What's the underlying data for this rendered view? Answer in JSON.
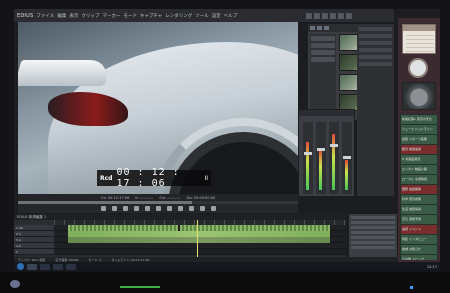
{
  "app": {
    "name": "EDIUS",
    "menu": [
      "ファイル",
      "編集",
      "表示",
      "クリップ",
      "マーカー",
      "モード",
      "キャプチャ",
      "レンダリング",
      "ツール",
      "設定",
      "ヘルプ"
    ]
  },
  "viewer": {
    "timecode_label": "Rcd",
    "timecode_value": "00 : 12 : 17 : 06",
    "timecode_suffix": "II",
    "status": [
      "Cur 00:12:17:06",
      "In --:--:--:--",
      "Out --:--:--:--",
      "Dur 00:00:00:00"
    ],
    "scrub_progress": 0.62
  },
  "timeline": {
    "title": "EDIUS 新規編集 1",
    "tracks": [
      "1 VA",
      "2 V",
      "3 A",
      "4 A",
      "T"
    ],
    "playhead_fraction": 0.49
  },
  "statusbar": [
    "ディスク: 82% 使用",
    "空き容量 100GB",
    "カード: 2",
    "タイムライン: 00:12:17:06"
  ],
  "sidebar": {
    "news_items": [
      "新着記事1 東京の天気",
      "ニュース ヘッドライン",
      "話題 スポーツ結果",
      "経済 株価速報",
      "IT 新製品発表",
      "エンタメ 映画公開",
      "ローカル 交通情報",
      "国際 会談開催",
      "科学 研究成果",
      "生活 健康情報",
      "天気 週間予報",
      "速報 イベント",
      "特集 インタビュー",
      "地域 お知らせ",
      "その他 トピック"
    ]
  },
  "taskbar": {
    "clock": "12:17"
  }
}
